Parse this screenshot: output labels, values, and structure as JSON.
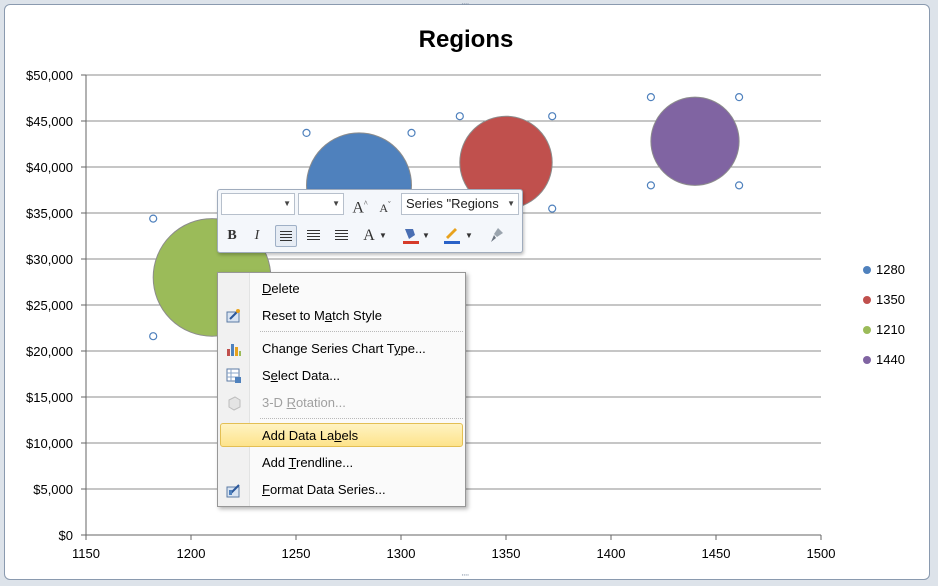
{
  "chart_data": {
    "type": "scatter",
    "subtype": "bubble",
    "title": "Regions",
    "xlim": [
      1150,
      1500
    ],
    "ylim": [
      0,
      50000
    ],
    "x_ticks": [
      "1150",
      "1200",
      "1250",
      "1300",
      "1350",
      "1400",
      "1450",
      "1500"
    ],
    "y_ticks": [
      "$0",
      "$5,000",
      "$10,000",
      "$15,000",
      "$20,000",
      "$25,000",
      "$30,000",
      "$35,000",
      "$40,000",
      "$45,000",
      "$50,000"
    ],
    "grid": true,
    "legend_position": "right",
    "series": [
      {
        "name": "1280",
        "x": 1280,
        "y": 38000,
        "r": 25,
        "color": "#4f81bd"
      },
      {
        "name": "1350",
        "x": 1350,
        "y": 40500,
        "r": 22,
        "color": "#c0504d"
      },
      {
        "name": "1210",
        "x": 1210,
        "y": 28000,
        "r": 28,
        "color": "#9bbb59"
      },
      {
        "name": "1440",
        "x": 1440,
        "y": 42800,
        "r": 21,
        "color": "#8064a2"
      }
    ]
  },
  "mini_toolbar": {
    "series_selector": "Series \"Regions"
  },
  "context_menu": {
    "items": [
      {
        "label": "Delete",
        "icon": "none",
        "disabled": false
      },
      {
        "label": "Reset to Match Style",
        "icon": "reset-style-icon",
        "disabled": false
      },
      {
        "label": "Change Series Chart Type...",
        "icon": "chart-type-icon",
        "disabled": false
      },
      {
        "label": "Select Data...",
        "icon": "select-data-icon",
        "disabled": false
      },
      {
        "label": "3-D Rotation...",
        "icon": "rotation-3d-icon",
        "disabled": true
      },
      {
        "label": "Add Data Labels",
        "icon": "none",
        "disabled": false
      },
      {
        "label": "Add Trendline...",
        "icon": "none",
        "disabled": false
      },
      {
        "label": "Format Data Series...",
        "icon": "format-series-icon",
        "disabled": false
      }
    ]
  },
  "colors": {
    "accent_hover": "#fde38b",
    "gridline": "#8c8c8c"
  }
}
